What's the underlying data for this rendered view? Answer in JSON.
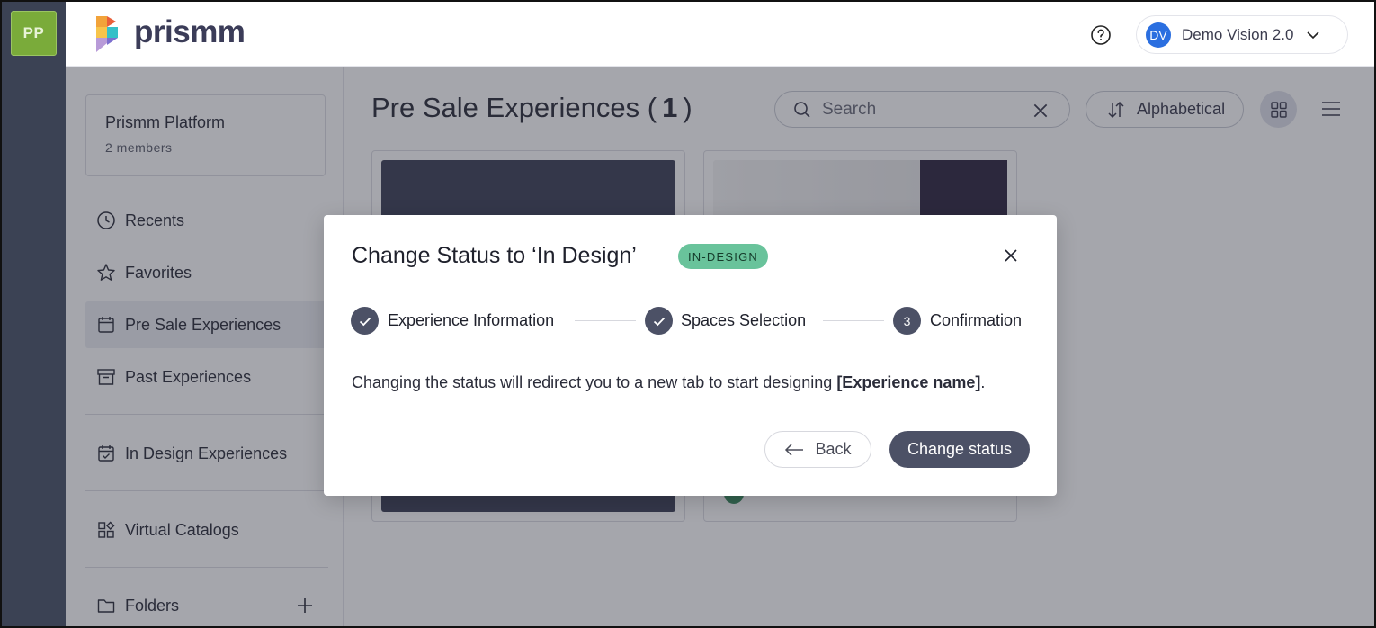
{
  "workspace_badge": "PP",
  "brand": {
    "name": "prismm"
  },
  "user": {
    "initials": "DV",
    "name": "Demo Vision 2.0"
  },
  "sidebar": {
    "workspace_name": "Prismm Platform",
    "workspace_members": "2 members",
    "items": [
      {
        "label": "Recents",
        "icon": "clock-icon"
      },
      {
        "label": "Favorites",
        "icon": "star-icon"
      },
      {
        "label": "Pre Sale Experiences",
        "icon": "calendar-icon",
        "active": true
      },
      {
        "label": "Past Experiences",
        "icon": "archive-icon"
      },
      {
        "label": "In Design Experiences",
        "icon": "calendar-check-icon"
      },
      {
        "label": "Virtual Catalogs",
        "icon": "catalog-icon"
      },
      {
        "label": "Folders",
        "icon": "folder-icon"
      }
    ]
  },
  "main": {
    "title": "Pre Sale Experiences",
    "count": "1",
    "search_placeholder": "Search",
    "sort_label": "Alphabetical"
  },
  "modal": {
    "title": "Change Status to ‘In Design’",
    "badge": "IN-DESIGN",
    "steps": [
      {
        "label": "Experience Information",
        "state": "done"
      },
      {
        "label": "Spaces Selection",
        "state": "done"
      },
      {
        "number": "3",
        "label": "Confirmation",
        "state": "current"
      }
    ],
    "message_prefix": "Changing the status will redirect you to a new tab to start designing ",
    "message_name": "[Experience name]",
    "message_suffix": ".",
    "back_label": "Back",
    "primary_label": "Change status"
  },
  "colors": {
    "rail": "#3b4254",
    "workspace_badge": "#7aab3a",
    "primary": "#4c5166",
    "status_badge": "#69c39b",
    "avatar": "#2b6fe0"
  }
}
